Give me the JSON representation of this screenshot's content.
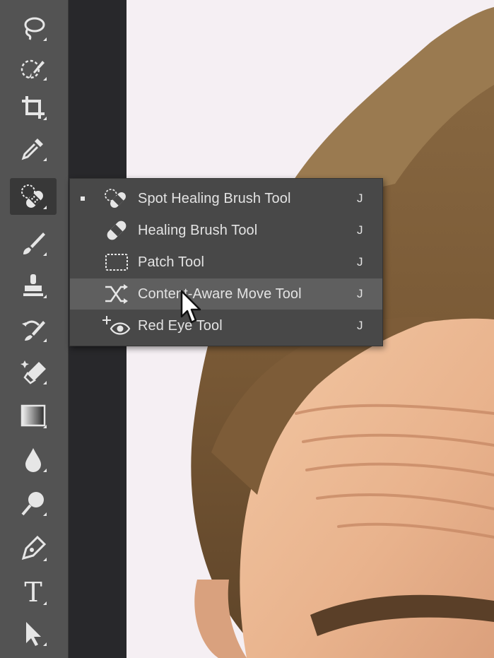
{
  "toolbar": {
    "tools": [
      {
        "name": "lasso-tool-icon",
        "active": false
      },
      {
        "name": "quick-selection-tool-icon",
        "active": false
      },
      {
        "name": "crop-tool-icon",
        "active": false
      },
      {
        "name": "eyedropper-tool-icon",
        "active": false
      },
      {
        "name": "spot-healing-brush-tool-icon",
        "active": true
      },
      {
        "name": "brush-tool-icon",
        "active": false
      },
      {
        "name": "clone-stamp-tool-icon",
        "active": false
      },
      {
        "name": "history-brush-tool-icon",
        "active": false
      },
      {
        "name": "eraser-tool-icon",
        "active": false
      },
      {
        "name": "gradient-tool-icon",
        "active": false
      },
      {
        "name": "blur-tool-icon",
        "active": false
      },
      {
        "name": "dodge-tool-icon",
        "active": false
      },
      {
        "name": "pen-tool-icon",
        "active": false
      },
      {
        "name": "type-tool-icon",
        "active": false
      },
      {
        "name": "path-selection-tool-icon",
        "active": false
      }
    ],
    "type_tool_glyph": "T"
  },
  "flyout": {
    "items": [
      {
        "label": "Spot Healing Brush Tool",
        "shortcut": "J",
        "selected": true,
        "hover": false,
        "icon": "spot-healing-brush-icon"
      },
      {
        "label": "Healing Brush Tool",
        "shortcut": "J",
        "selected": false,
        "hover": false,
        "icon": "healing-brush-icon"
      },
      {
        "label": "Patch Tool",
        "shortcut": "J",
        "selected": false,
        "hover": false,
        "icon": "patch-icon"
      },
      {
        "label": "Content-Aware Move Tool",
        "shortcut": "J",
        "selected": false,
        "hover": true,
        "icon": "content-aware-move-icon"
      },
      {
        "label": "Red Eye Tool",
        "shortcut": "J",
        "selected": false,
        "hover": false,
        "icon": "red-eye-icon"
      }
    ]
  },
  "colors": {
    "toolbar_bg": "#535353",
    "menu_bg": "#484848",
    "menu_hover": "#5f5f5f",
    "text": "#e3e3e3",
    "canvas_bg": "#f5eff3"
  }
}
